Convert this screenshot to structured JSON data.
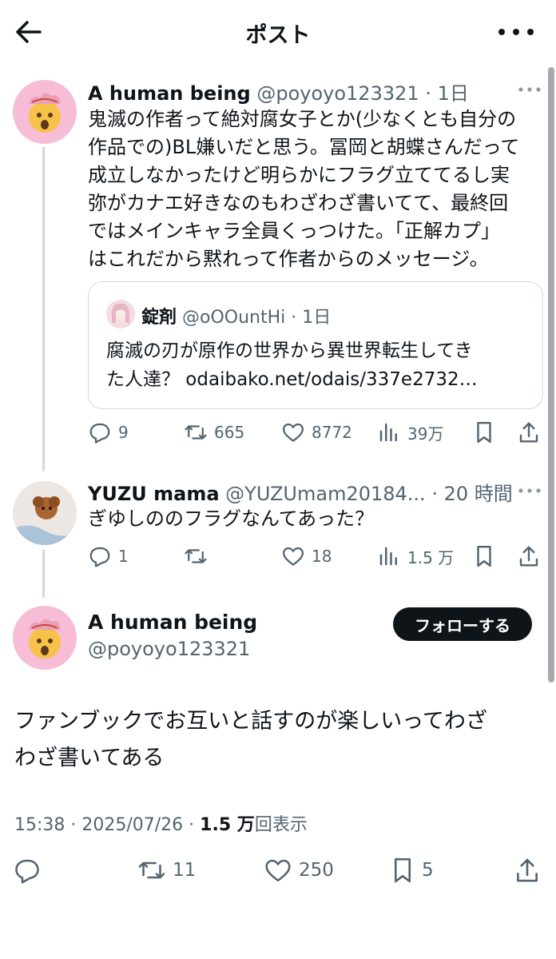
{
  "header": {
    "title": "ポスト",
    "back_icon": "arrow-left-icon",
    "more_icon": "more-horizontal-icon"
  },
  "post1": {
    "name": "A human being",
    "handle": "@poyoyo123321",
    "time": "· 1日",
    "text_lines": [
      "鬼滅の作者って絶対腐女子とか(少なくとも自分の",
      "作品での)BL嫌いだと思う。冨岡と胡蝶さんだって",
      "成立しなかったけど明らかにフラグ立ててるし実",
      "弥がカナエ好きなのもわざわざ書いてて、最終回",
      "ではメインキャラ全員くっつけた。「正解カプ」",
      "はこれだから黙れって作者からのメッセージ。"
    ],
    "quote": {
      "name": "錠剤",
      "handle": "@oOOuntHi",
      "time": "· 1日",
      "text_lines": [
        "腐滅の刃が原作の世界から異世界転生してき",
        "た人達？ odaibako.net/odais/337e2732…"
      ]
    },
    "replies": "9",
    "reposts": "665",
    "likes": "8772",
    "views": "39万"
  },
  "post2": {
    "name": "YUZU mama",
    "handle": "@YUZUmam20184...",
    "time": "· 20 時間",
    "text": "ぎゆしののフラグなんてあった？",
    "replies": "1",
    "reposts": "",
    "likes": "18",
    "views": "1.5 万"
  },
  "main_post": {
    "name": "A human being",
    "handle": "@poyoyo123321",
    "follow_label": "フォローする",
    "text_lines": [
      "ファンブックでお互いと話すのが楽しいってわざ",
      "わざ書いてある"
    ],
    "time": "15:38 · 2025/07/26 · ",
    "views_count": "1.5 万",
    "views_label": "回表示",
    "replies": "",
    "reposts": "11",
    "likes": "250",
    "bookmarks": "5"
  },
  "colors": {
    "text": "#0f1419",
    "muted": "#536471",
    "border": "#cfd9de",
    "avatar_pink": "#f7bcd6"
  }
}
